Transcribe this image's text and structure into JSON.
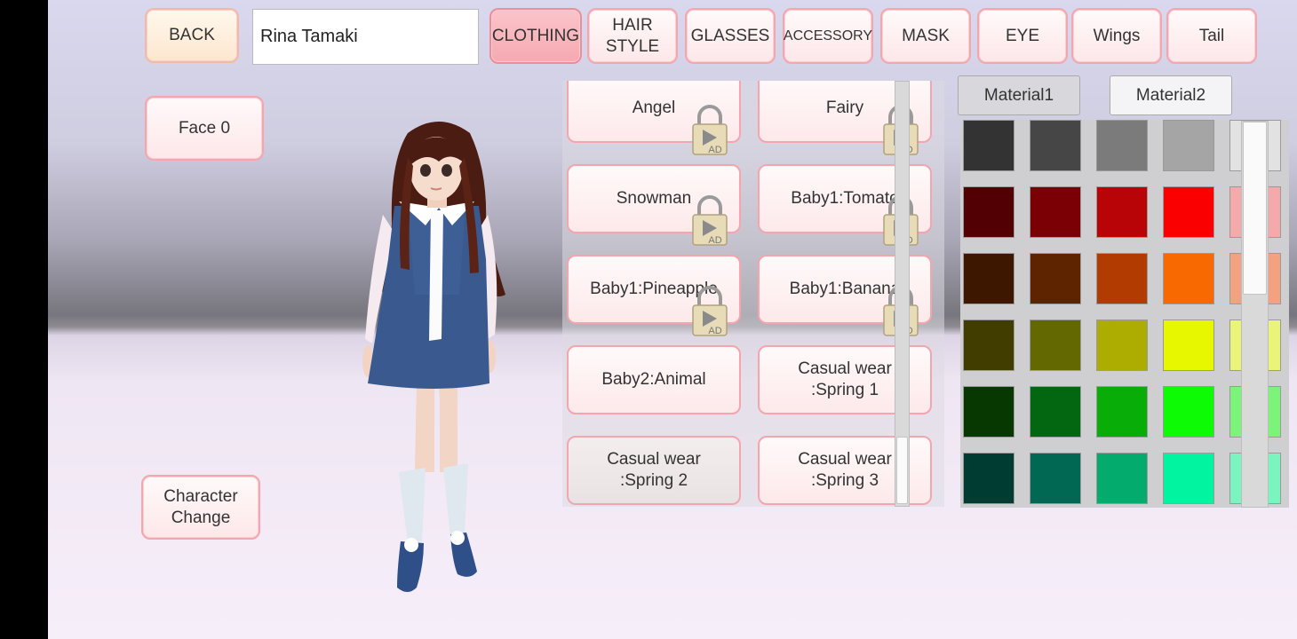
{
  "toolbar": {
    "back_label": "BACK",
    "name_value": "Rina Tamaki",
    "tabs": [
      "CLOTHING",
      "HAIR\nSTYLE",
      "GLASSES",
      "ACCESSORY",
      "MASK",
      "EYE",
      "Wings",
      "Tail"
    ],
    "selected_tab": "CLOTHING"
  },
  "left": {
    "face_label": "Face 0",
    "character_change_label": "Character\nChange"
  },
  "items": [
    {
      "label": "Angel",
      "locked": true
    },
    {
      "label": "Fairy",
      "locked": true
    },
    {
      "label": "Snowman",
      "locked": true
    },
    {
      "label": "Baby1:Tomato",
      "locked": true
    },
    {
      "label": "Baby1:Pineapple",
      "locked": true
    },
    {
      "label": "Baby1:Banana",
      "locked": true
    },
    {
      "label": "Baby2:Animal",
      "locked": false
    },
    {
      "label": "Casual wear\n:Spring 1",
      "locked": false
    },
    {
      "label": "Casual wear\n:Spring 2",
      "locked": false,
      "selected": true
    },
    {
      "label": "Casual wear\n:Spring 3",
      "locked": false
    }
  ],
  "lock_badge": "AD",
  "materials": {
    "tab1": "Material1",
    "tab2": "Material2",
    "selected": "Material1"
  },
  "swatches": [
    [
      "#333333",
      "#464646",
      "#7b7b7b",
      "#a5a5a5",
      "#e2e2e2"
    ],
    [
      "#520004",
      "#7a0006",
      "#b80407",
      "#fb0000",
      "#f4aaab"
    ],
    [
      "#3e1700",
      "#5e2400",
      "#b13b01",
      "#f86a01",
      "#f2a27f"
    ],
    [
      "#413c00",
      "#646800",
      "#adac00",
      "#e7f700",
      "#e9f478"
    ],
    [
      "#073802",
      "#036610",
      "#08ad08",
      "#0dfc06",
      "#7cf47a"
    ],
    [
      "#003c31",
      "#016853",
      "#03ac6d",
      "#01f49f",
      "#7bf5bf"
    ]
  ],
  "colors": {
    "button_border": "#f3a6ae",
    "selected_tab": "#f6a9b1"
  }
}
